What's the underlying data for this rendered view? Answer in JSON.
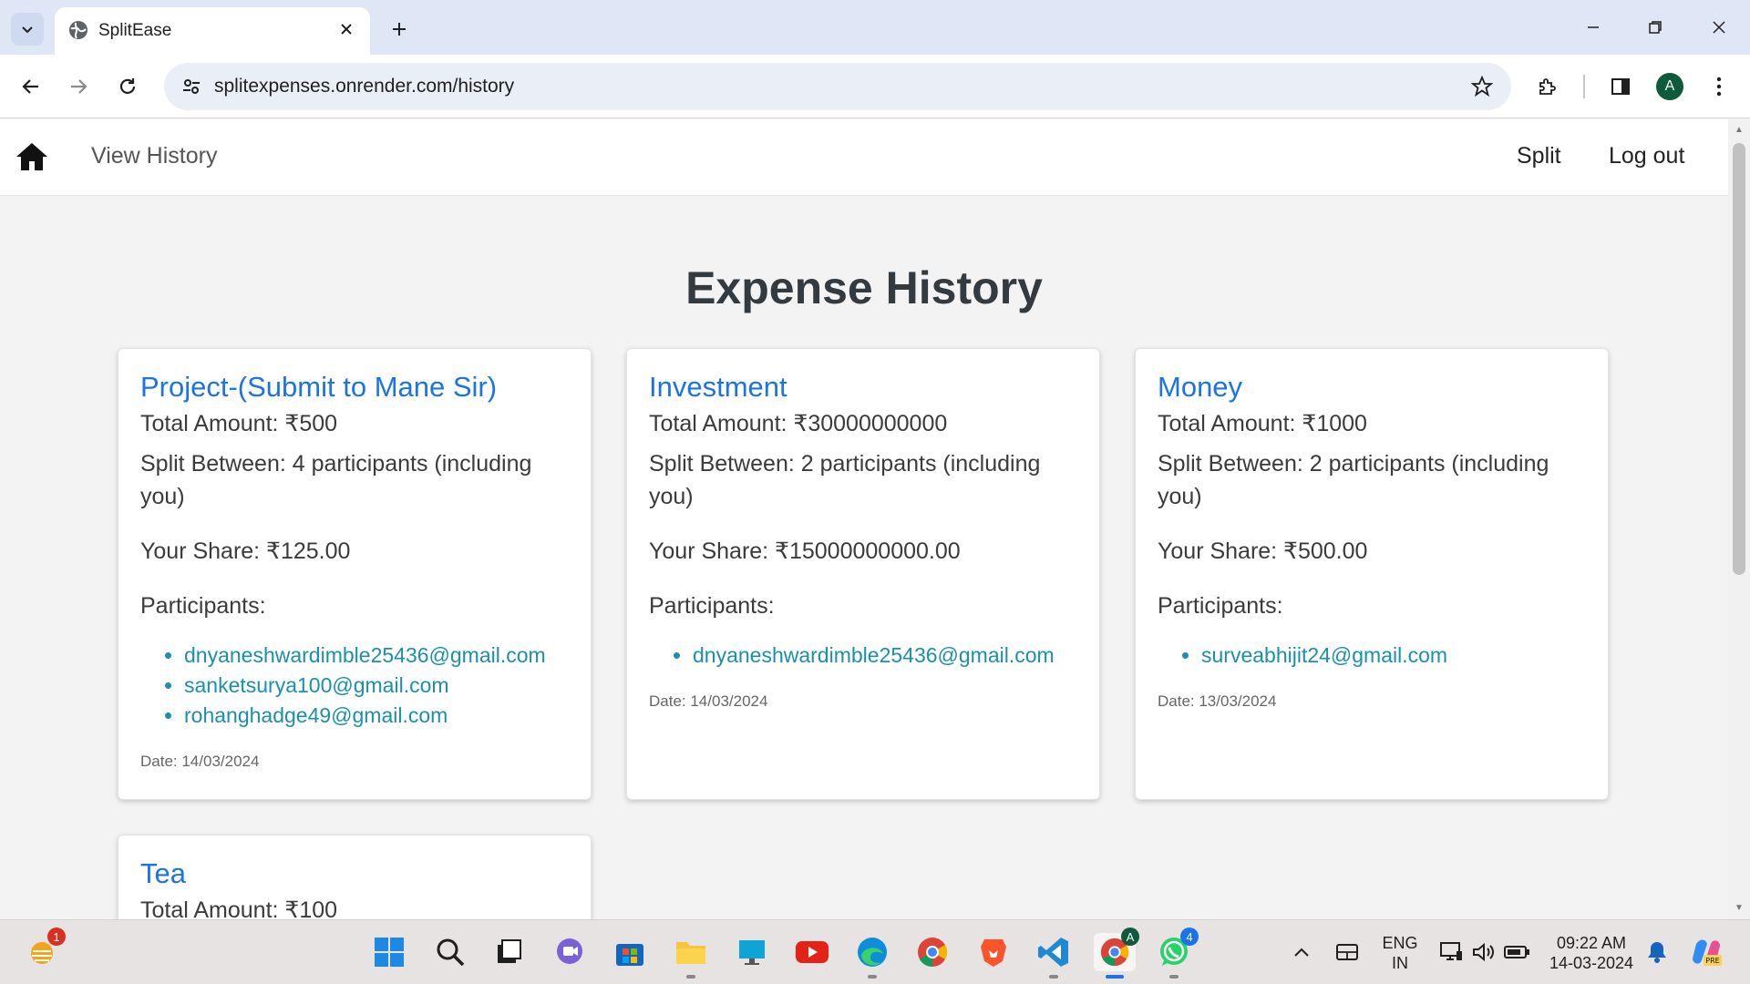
{
  "browser": {
    "tab_title": "SplitEase",
    "url": "splitexpenses.onrender.com/history",
    "profile_initial": "A"
  },
  "nav": {
    "view_history": "View History",
    "split": "Split",
    "logout": "Log out"
  },
  "page_title": "Expense History",
  "expenses": [
    {
      "title": "Project-(Submit to Mane Sir)",
      "total": "Total Amount: ₹500",
      "split": "Split Between: 4 participants (including you)",
      "share": "Your Share: ₹125.00",
      "participants_label": "Participants:",
      "participants": [
        "dnyaneshwardimble25436@gmail.com",
        "sanketsurya100@gmail.com",
        "rohanghadge49@gmail.com"
      ],
      "date": "Date: 14/03/2024"
    },
    {
      "title": "Investment",
      "total": "Total Amount: ₹30000000000",
      "split": "Split Between: 2 participants (including you)",
      "share": "Your Share: ₹15000000000.00",
      "participants_label": "Participants:",
      "participants": [
        "dnyaneshwardimble25436@gmail.com"
      ],
      "date": "Date: 14/03/2024"
    },
    {
      "title": "Money",
      "total": "Total Amount: ₹1000",
      "split": "Split Between: 2 participants (including you)",
      "share": "Your Share: ₹500.00",
      "participants_label": "Participants:",
      "participants": [
        "surveabhijit24@gmail.com"
      ],
      "date": "Date: 13/03/2024"
    },
    {
      "title": "Tea",
      "total": "Total Amount: ₹100"
    }
  ],
  "taskbar": {
    "widget_badge": "1",
    "whatsapp_badge": "4",
    "chrome_profile": "A",
    "lang_line1": "ENG",
    "lang_line2": "IN",
    "time": "09:22 AM",
    "date": "14-03-2024"
  },
  "colors": {
    "link": "#1a73e8",
    "participant": "#1a8fb0",
    "page_bg": "#f3f3f3"
  }
}
